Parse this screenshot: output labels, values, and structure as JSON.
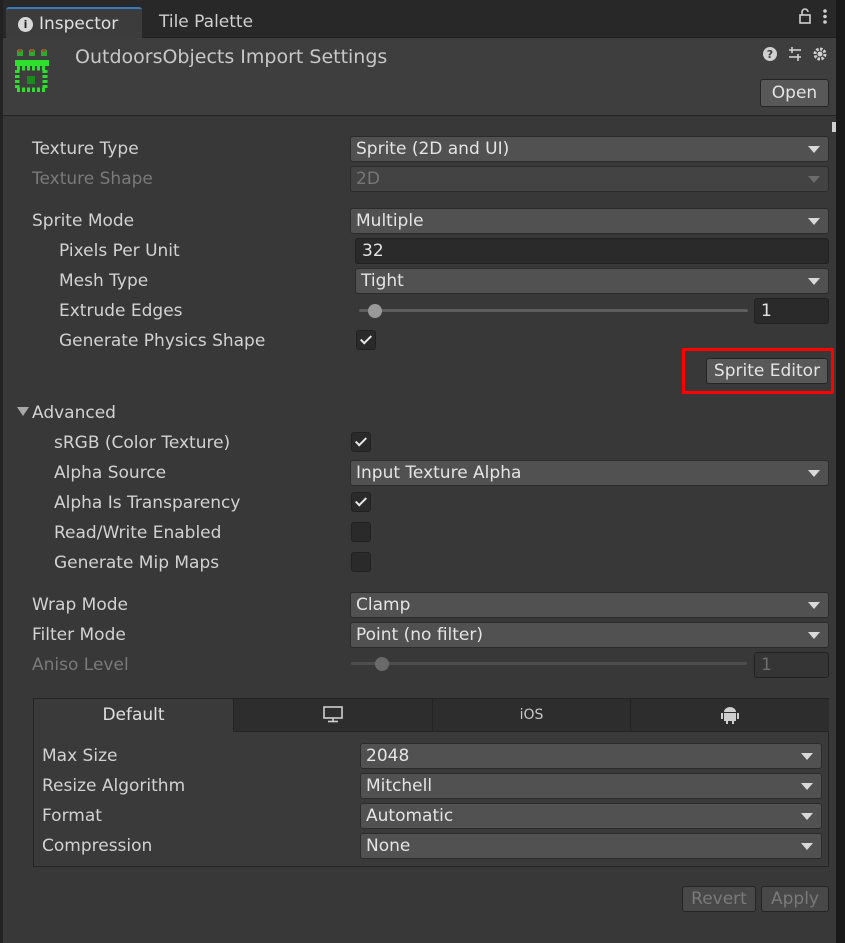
{
  "tabs": {
    "inspector": "Inspector",
    "tile_palette": "Tile Palette"
  },
  "header": {
    "title": "OutdoorsObjects Import Settings",
    "open_label": "Open"
  },
  "fields": {
    "texture_type": {
      "label": "Texture Type",
      "value": "Sprite (2D and UI)"
    },
    "texture_shape": {
      "label": "Texture Shape",
      "value": "2D"
    },
    "sprite_mode": {
      "label": "Sprite Mode",
      "value": "Multiple"
    },
    "pixels_per_unit": {
      "label": "Pixels Per Unit",
      "value": "32"
    },
    "mesh_type": {
      "label": "Mesh Type",
      "value": "Tight"
    },
    "extrude_edges": {
      "label": "Extrude Edges",
      "value": "1"
    },
    "generate_physics_shape": {
      "label": "Generate Physics Shape",
      "checked": true
    },
    "sprite_editor_label": "Sprite Editor"
  },
  "advanced": {
    "label": "Advanced",
    "srgb": {
      "label": "sRGB (Color Texture)",
      "checked": true
    },
    "alpha_source": {
      "label": "Alpha Source",
      "value": "Input Texture Alpha"
    },
    "alpha_is_transparency": {
      "label": "Alpha Is Transparency",
      "checked": true
    },
    "read_write": {
      "label": "Read/Write Enabled",
      "checked": false
    },
    "mip_maps": {
      "label": "Generate Mip Maps",
      "checked": false
    }
  },
  "sampling": {
    "wrap_mode": {
      "label": "Wrap Mode",
      "value": "Clamp"
    },
    "filter_mode": {
      "label": "Filter Mode",
      "value": "Point (no filter)"
    },
    "aniso_level": {
      "label": "Aniso Level",
      "value": "1"
    }
  },
  "platform": {
    "tabs": {
      "default": "Default",
      "ios": "iOS"
    },
    "max_size": {
      "label": "Max Size",
      "value": "2048"
    },
    "resize_algorithm": {
      "label": "Resize Algorithm",
      "value": "Mitchell"
    },
    "format": {
      "label": "Format",
      "value": "Automatic"
    },
    "compression": {
      "label": "Compression",
      "value": "None"
    }
  },
  "footer": {
    "revert_label": "Revert",
    "apply_label": "Apply"
  },
  "colors": {
    "highlight": "#ff0000",
    "background": "#383838",
    "active_tab_accent": "#3a79bb"
  }
}
